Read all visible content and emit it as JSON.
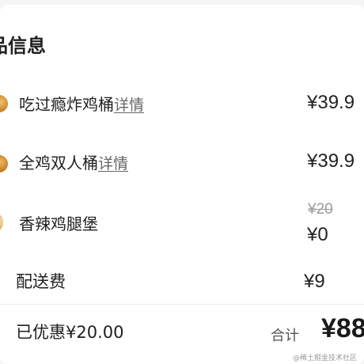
{
  "section": {
    "title": "品信息"
  },
  "items": [
    {
      "name": "吃过瘾炸鸡桶",
      "detail": "详情",
      "price": "¥39.9",
      "thumb_icon": "fried-chicken-bucket"
    },
    {
      "name": "全鸡双人桶",
      "detail": "详情",
      "price": "¥39.9",
      "thumb_icon": "fried-chicken"
    },
    {
      "name": "香辣鸡腿堡",
      "original_price": "¥20",
      "price": "¥0",
      "thumb_icon": "burger"
    }
  ],
  "delivery": {
    "label": "配送费",
    "price": "¥9"
  },
  "summary": {
    "discount": "已优惠¥20.00",
    "total_label": "合计",
    "total_value": "¥88"
  },
  "watermark": "@稀土掘金技术社区"
}
